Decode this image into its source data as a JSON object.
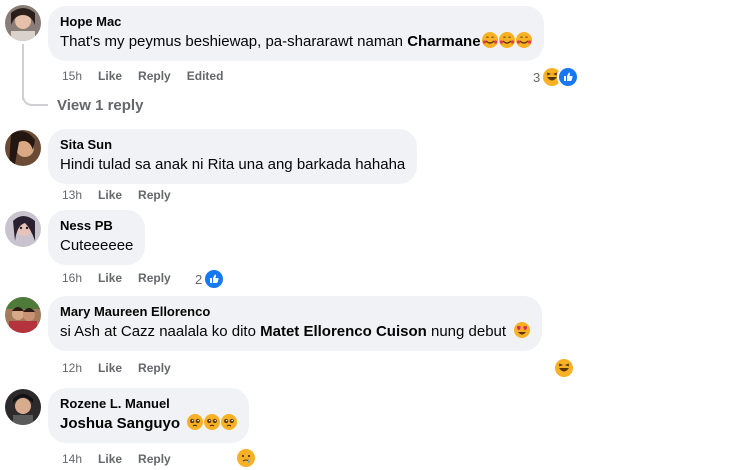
{
  "comments": [
    {
      "author": "Hope Mac",
      "text_parts": [
        "That's my peymus beshiewap, pa-shararawt naman ",
        "Charmane"
      ],
      "emojis": [
        "smiling-face-with-hearts-icon",
        "smiling-face-with-hearts-icon",
        "smiling-face-with-hearts-icon"
      ],
      "time": "15h",
      "like": "Like",
      "reply": "Reply",
      "edited": "Edited",
      "reaction_count": "3"
    },
    {
      "author": "Sita Sun",
      "text": "Hindi tulad sa anak ni Rita una ang barkada hahaha",
      "time": "13h",
      "like": "Like",
      "reply": "Reply"
    },
    {
      "author": "Ness PB",
      "text": "Cuteeeeee",
      "time": "16h",
      "like": "Like",
      "reply": "Reply",
      "reaction_count": "2"
    },
    {
      "author": "Mary Maureen Ellorenco",
      "text_parts": [
        "si Ash at Cazz naalala ko dito ",
        "Matet Ellorenco Cuison",
        " nung debut"
      ],
      "time": "12h",
      "like": "Like",
      "reply": "Reply"
    },
    {
      "author": "Rozene L. Manuel",
      "mention": "Joshua Sanguyo",
      "time": "14h",
      "like": "Like",
      "reply": "Reply"
    }
  ],
  "view_replies": "View 1 reply",
  "colors": {
    "bubble": "#f0f2f5",
    "meta": "#65676b",
    "like_blue": "#1877f2",
    "haha_yellow": "#f7b125"
  }
}
